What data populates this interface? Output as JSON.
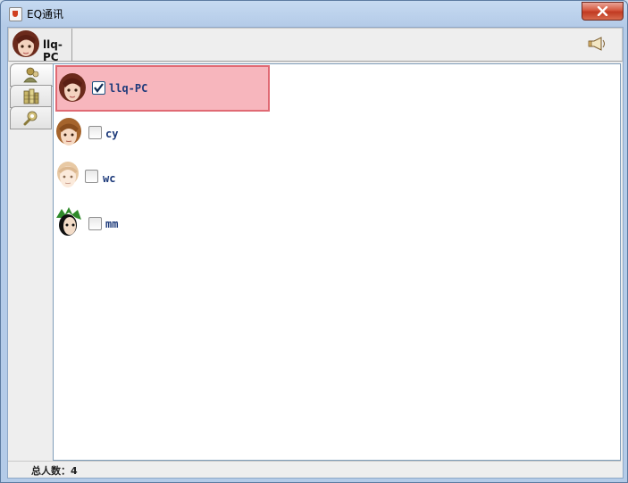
{
  "window": {
    "title": "EQ通讯"
  },
  "header": {
    "user_name": "llq-PC",
    "speaker_icon": "speaker-icon"
  },
  "side_tabs": [
    {
      "icon": "contacts-icon"
    },
    {
      "icon": "groups-icon"
    },
    {
      "icon": "settings-icon"
    }
  ],
  "contacts": [
    {
      "name": "llq-PC",
      "checked": true,
      "avatar": "avatar-brown-hair"
    },
    {
      "name": "cy",
      "checked": false,
      "avatar": "avatar-light-brown-hair"
    },
    {
      "name": "wc",
      "checked": false,
      "avatar": "avatar-blonde-hair"
    },
    {
      "name": "mm",
      "checked": false,
      "avatar": "avatar-green-hair"
    }
  ],
  "status": {
    "total_label": "总人数：4"
  },
  "colors": {
    "selected_row_bg": "#f7b6bd",
    "selected_row_border": "#e06a74",
    "name_text": "#1d3a7a"
  }
}
